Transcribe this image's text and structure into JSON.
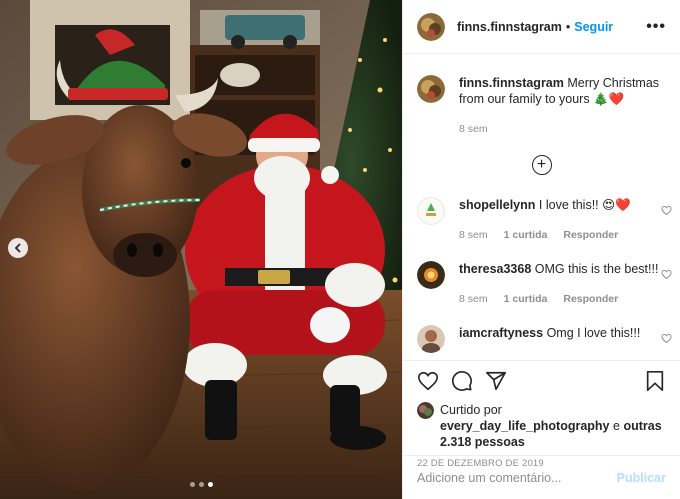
{
  "post": {
    "username": "finns.finnstagram",
    "separator": "•",
    "follow_label": "Seguir",
    "more_label": "•••",
    "caption_text": "Merry Christmas from our family to yours 🎄❤️",
    "caption_time": "8 sem",
    "load_more_label": "+"
  },
  "comments": [
    {
      "username": "shopellelynn",
      "text": "I love this!! 😍❤️",
      "time": "8 sem",
      "likes": "",
      "reply": "Responder"
    },
    {
      "username": "theresa3368",
      "text": "OMG this is the best!!!",
      "time": "8 sem",
      "likes": "1 curtida",
      "reply": "Responder"
    },
    {
      "username": "iamcraftyness",
      "text": "Omg I love this!!!",
      "time": "",
      "likes": "",
      "reply": ""
    }
  ],
  "comment0_likes": "1 curtida",
  "likes": {
    "prefix": "Curtido por",
    "user": "every_day_life_photography",
    "conj": "e",
    "others": "outras 2.318 pessoas"
  },
  "date": "22 DE DEZEMBRO DE 2019",
  "add_comment": {
    "placeholder": "Adicione um comentário...",
    "publish_label": "Publicar"
  },
  "colors": {
    "accent": "#0095f6",
    "publish_disabled": "#b2dffc",
    "heart": "#ed4956"
  },
  "carousel": {
    "dots": 3,
    "active_index": 2
  }
}
